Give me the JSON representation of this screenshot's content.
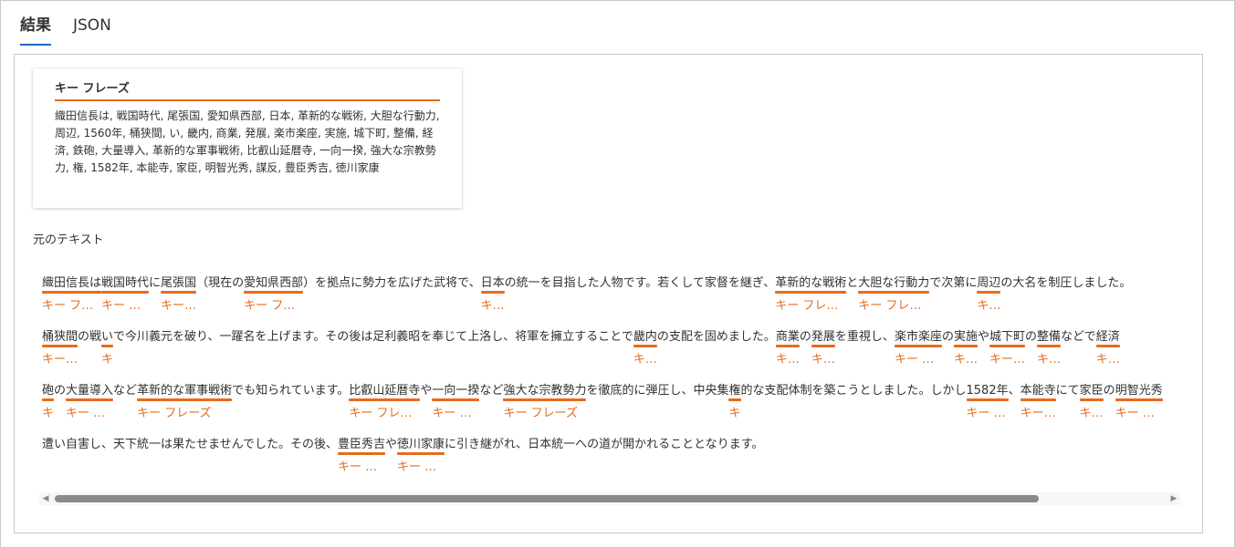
{
  "tabs": [
    {
      "label": "結果",
      "active": true
    },
    {
      "label": "JSON",
      "active": false
    }
  ],
  "key_phrases_card": {
    "title": "キー フレーズ",
    "body": "織田信長は, 戦国時代, 尾張国, 愛知県西部, 日本, 革新的な戦術, 大胆な行動力, 周辺, 1560年, 桶狭間, い, 畿内, 商業, 発展, 楽市楽座, 実施, 城下町, 整備, 経済, 鉄砲, 大量導入, 革新的な軍事戦術, 比叡山延暦寺, 一向一揆, 強大な宗教勢力, 権, 1582年, 本能寺, 家臣, 明智光秀, 謀反, 豊臣秀吉, 徳川家康"
  },
  "original_text_label": "元のテキスト",
  "tag_label": "キー フレーズ",
  "lines": [
    [
      {
        "t": "織田信長は",
        "k": true
      },
      {
        "t": "戦国時代",
        "k": true
      },
      {
        "t": "に"
      },
      {
        "t": "尾張国",
        "k": true
      },
      {
        "t": "（現在の"
      },
      {
        "t": "愛知県西部",
        "k": true
      },
      {
        "t": "）を拠点に勢力を広げた武将で、"
      },
      {
        "t": "日本",
        "k": true
      },
      {
        "t": "の統一を目指した人物です。若くして家督を継ぎ、"
      },
      {
        "t": "革新的な戦術",
        "k": true
      },
      {
        "t": "と"
      },
      {
        "t": "大胆な行動力",
        "k": true
      },
      {
        "t": "で次第に"
      },
      {
        "t": "周辺",
        "k": true
      },
      {
        "t": "の大名を制圧しました。"
      }
    ],
    [
      {
        "t": "桶狭間",
        "k": true
      },
      {
        "t": "の戦"
      },
      {
        "t": "い",
        "k": true
      },
      {
        "t": "で今川義元を破り、一躍名を上げます。その後は足利義昭を奉じて上洛し、将軍を擁立することで"
      },
      {
        "t": "畿内",
        "k": true
      },
      {
        "t": "の支配を固めました。"
      },
      {
        "t": "商業",
        "k": true
      },
      {
        "t": "の"
      },
      {
        "t": "発展",
        "k": true
      },
      {
        "t": "を重視し、"
      },
      {
        "t": "楽市楽座",
        "k": true
      },
      {
        "t": "の"
      },
      {
        "t": "実施",
        "k": true
      },
      {
        "t": "や"
      },
      {
        "t": "城下町",
        "k": true
      },
      {
        "t": "の"
      },
      {
        "t": "整備",
        "k": true
      },
      {
        "t": "などで"
      },
      {
        "t": "経済",
        "k": true
      }
    ],
    [
      {
        "t": "砲",
        "k": true
      },
      {
        "t": "の"
      },
      {
        "t": "大量導入",
        "k": true
      },
      {
        "t": "など"
      },
      {
        "t": "革新的な軍事戦術",
        "k": true
      },
      {
        "t": "でも知られています。"
      },
      {
        "t": "比叡山延暦寺",
        "k": true
      },
      {
        "t": "や"
      },
      {
        "t": "一向一揆",
        "k": true
      },
      {
        "t": "など"
      },
      {
        "t": "強大な宗教勢力",
        "k": true
      },
      {
        "t": "を徹底的に弾圧し、中央集"
      },
      {
        "t": "権",
        "k": true
      },
      {
        "t": "的な支配体制を築こうとしました。しかし"
      },
      {
        "t": "1582年",
        "k": true
      },
      {
        "t": "、"
      },
      {
        "t": "本能寺",
        "k": true
      },
      {
        "t": "にて"
      },
      {
        "t": "家臣",
        "k": true
      },
      {
        "t": "の"
      },
      {
        "t": "明智光秀",
        "k": true
      }
    ],
    [
      {
        "t": "遭い自害し、天下統一は果たせませんでした。その後、"
      },
      {
        "t": "豊臣秀吉",
        "k": true
      },
      {
        "t": "や"
      },
      {
        "t": "徳川家康",
        "k": true
      },
      {
        "t": "に引き継がれ、日本統一への道が開かれることとなります。"
      }
    ]
  ],
  "scrollbar": {
    "left_arrow": "◀",
    "right_arrow": "▶"
  },
  "colors": {
    "accent": "#e86a1d",
    "tab_underline": "#0f6cbd"
  }
}
